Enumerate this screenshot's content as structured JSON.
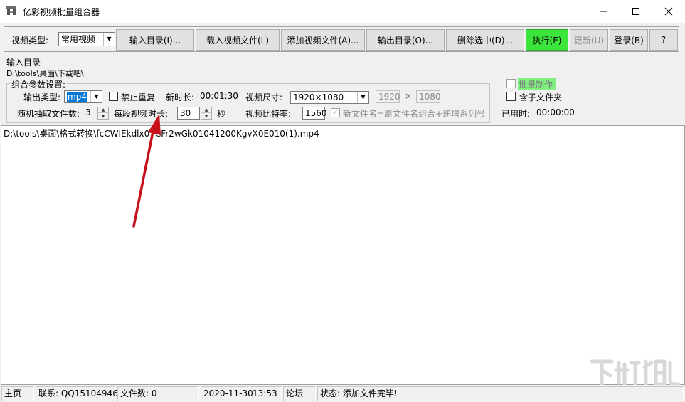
{
  "window": {
    "title": "亿彩视频批量组合器",
    "icon": "app-logo-icon",
    "controls": {
      "minimize": "minimize-icon",
      "maximize": "maximize-icon",
      "close": "close-icon"
    }
  },
  "toolbar": {
    "video_type_label": "视频类型:",
    "video_type_value": "常用视频",
    "input_dir_btn": "输入目录(I)...",
    "load_video_btn": "载入视频文件(L)",
    "add_video_btn": "添加视频文件(A)...",
    "output_dir_btn": "输出目录(O)...",
    "delete_selected_btn": "删除选中(D)...",
    "execute_btn": "执行(E)",
    "update_btn": "更新(U)",
    "login_btn": "登录(B)",
    "help_btn": "?",
    "execute_color": "#3ce43c"
  },
  "input_dir": {
    "label": "输入目录",
    "path": "D:\\tools\\桌面\\下载吧\\"
  },
  "params": {
    "group_title": "组合参数设置:",
    "output_type_label": "输出类型:",
    "output_type_value": "mp4",
    "no_repeat_label": "禁止重复",
    "new_duration_label": "新时长:",
    "new_duration_value": "00:01:30",
    "video_size_label": "视频尺寸:",
    "video_size_value": "1920×1080",
    "width_value": "1920",
    "times_sign": "×",
    "height_value": "1080",
    "random_count_label": "随机抽取文件数:",
    "random_count_value": "3",
    "segment_duration_label": "每段视频时长:",
    "segment_duration_value": "30",
    "seconds_unit": "秒",
    "bitrate_label": "视频比特率:",
    "bitrate_value": "1560",
    "new_filename_label": "新文件名=原文件名组合+递增系列号",
    "batch_label": "批量制作",
    "batch_highlight": "#80f080",
    "subfolder_label": "含子文件夹",
    "elapsed_label": "已用时:",
    "elapsed_value": "00:00:00"
  },
  "file_list": {
    "items": [
      "D:\\tools\\桌面\\格式转换\\fcCWIEkdlx07CFr2wGk01041200KgvX0E010(1).mp4"
    ]
  },
  "status_bar": {
    "home": "主页",
    "contact": "联系: QQ15104946",
    "file_count": "文件数: 0",
    "date": "2020-11-30",
    "time": "13:53",
    "forum": "论坛",
    "status": "状态: 添加文件完毕!"
  },
  "watermark": {
    "icon": "xiazaiba-watermark-logo"
  },
  "annotation": {
    "icon": "red-arrow-icon",
    "color": "#c8101a"
  }
}
